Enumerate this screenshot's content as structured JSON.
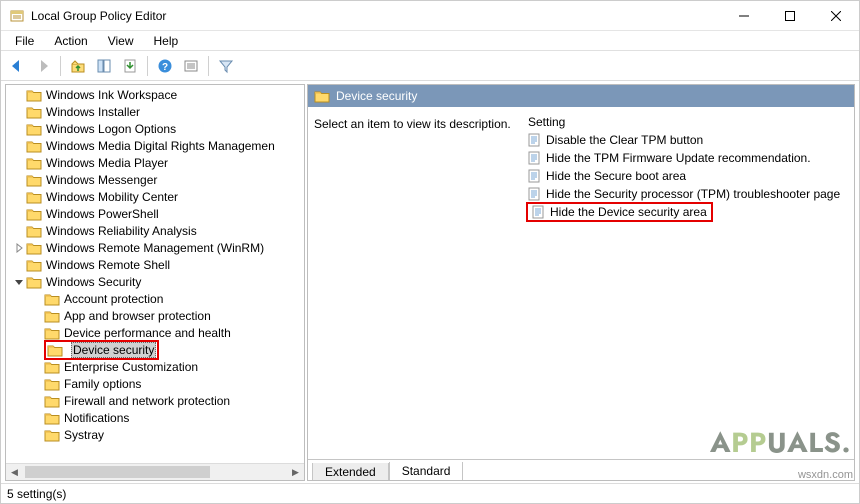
{
  "titlebar": {
    "title": "Local Group Policy Editor"
  },
  "menu": {
    "file": "File",
    "action": "Action",
    "view": "View",
    "help": "Help"
  },
  "tree": {
    "items": [
      {
        "label": "Windows Ink Workspace",
        "depth": 0
      },
      {
        "label": "Windows Installer",
        "depth": 0
      },
      {
        "label": "Windows Logon Options",
        "depth": 0
      },
      {
        "label": "Windows Media Digital Rights Managemen",
        "depth": 0
      },
      {
        "label": "Windows Media Player",
        "depth": 0
      },
      {
        "label": "Windows Messenger",
        "depth": 0
      },
      {
        "label": "Windows Mobility Center",
        "depth": 0
      },
      {
        "label": "Windows PowerShell",
        "depth": 0
      },
      {
        "label": "Windows Reliability Analysis",
        "depth": 0
      },
      {
        "label": "Windows Remote Management (WinRM)",
        "depth": 0,
        "twisty": "collapsed"
      },
      {
        "label": "Windows Remote Shell",
        "depth": 0
      },
      {
        "label": "Windows Security",
        "depth": 0,
        "twisty": "expanded"
      },
      {
        "label": "Account protection",
        "depth": 1
      },
      {
        "label": "App and browser protection",
        "depth": 1
      },
      {
        "label": "Device performance and health",
        "depth": 1
      },
      {
        "label": "Device security",
        "depth": 1,
        "selected": true,
        "highlight": true
      },
      {
        "label": "Enterprise Customization",
        "depth": 1
      },
      {
        "label": "Family options",
        "depth": 1
      },
      {
        "label": "Firewall and network protection",
        "depth": 1
      },
      {
        "label": "Notifications",
        "depth": 1
      },
      {
        "label": "Systray",
        "depth": 1
      }
    ]
  },
  "right": {
    "header": "Device security",
    "description": "Select an item to view its description.",
    "settings_header": "Setting",
    "settings": [
      {
        "label": "Disable the Clear TPM button"
      },
      {
        "label": "Hide the TPM Firmware Update recommendation."
      },
      {
        "label": "Hide the Secure boot area"
      },
      {
        "label": "Hide the Security processor (TPM) troubleshooter page"
      },
      {
        "label": "Hide the Device security area",
        "highlight": true
      }
    ],
    "tabs": {
      "extended": "Extended",
      "standard": "Standard"
    }
  },
  "status": {
    "text": "5 setting(s)"
  },
  "watermark": {
    "brand_pre": "A",
    "brand_mid": "PP",
    "brand_post": "UALS.",
    "site": "wsxdn.com"
  }
}
